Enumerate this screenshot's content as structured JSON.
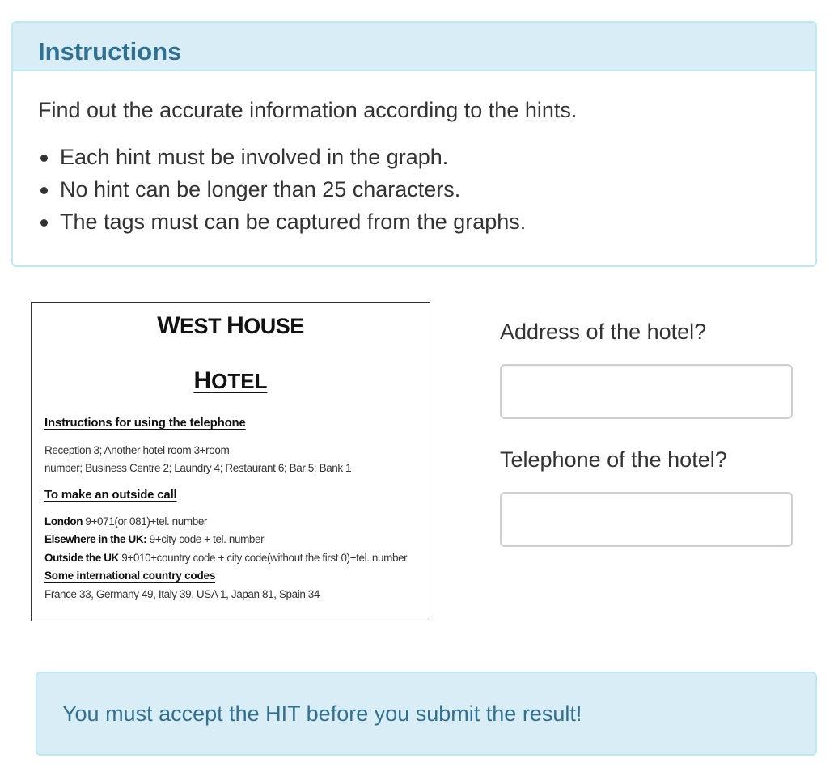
{
  "instructions": {
    "title": "Instructions",
    "intro": "Find out the accurate information according to the hints.",
    "rules": [
      "Each hint must be involved in the graph.",
      "No hint can be longer than 25 characters.",
      "The tags must can be captured from the graphs."
    ]
  },
  "hotel_image": {
    "title_line1_a": "W",
    "title_line1_b": "EST ",
    "title_line1_c": "H",
    "title_line1_d": "OUSE",
    "title_line2_a": "H",
    "title_line2_b": "OTEL",
    "section1": "Instructions for using the telephone",
    "internal_line1": "Reception 3; Another hotel room 3+room",
    "internal_line2": "number; Business  Centre 2; Laundry 4; Restaurant 6; Bar 5; Bank 1",
    "section2": "To make an outside call",
    "london_label": "London",
    "london_text": " 9+071(or 081)+tel. number",
    "uk_label": "Elsewhere in the UK:",
    "uk_text": " 9+city code + tel. number",
    "outside_label": "Outside the UK",
    "outside_text": " 9+010+country code + city code(without the first 0)+tel. number",
    "section3": "Some international country codes ",
    "codes_line": "France 33, Germany 49, Italy 39. USA 1, Japan 81, Spain 34"
  },
  "form": {
    "address_label": "Address of the hotel?",
    "address_value": "",
    "telephone_label": "Telephone of the hotel?",
    "telephone_value": ""
  },
  "alert": {
    "text": "You must accept the HIT before you submit the result!"
  },
  "colors": {
    "info_bg": "#d9edf7",
    "info_border": "#bce8f1",
    "info_text": "#31708f"
  }
}
